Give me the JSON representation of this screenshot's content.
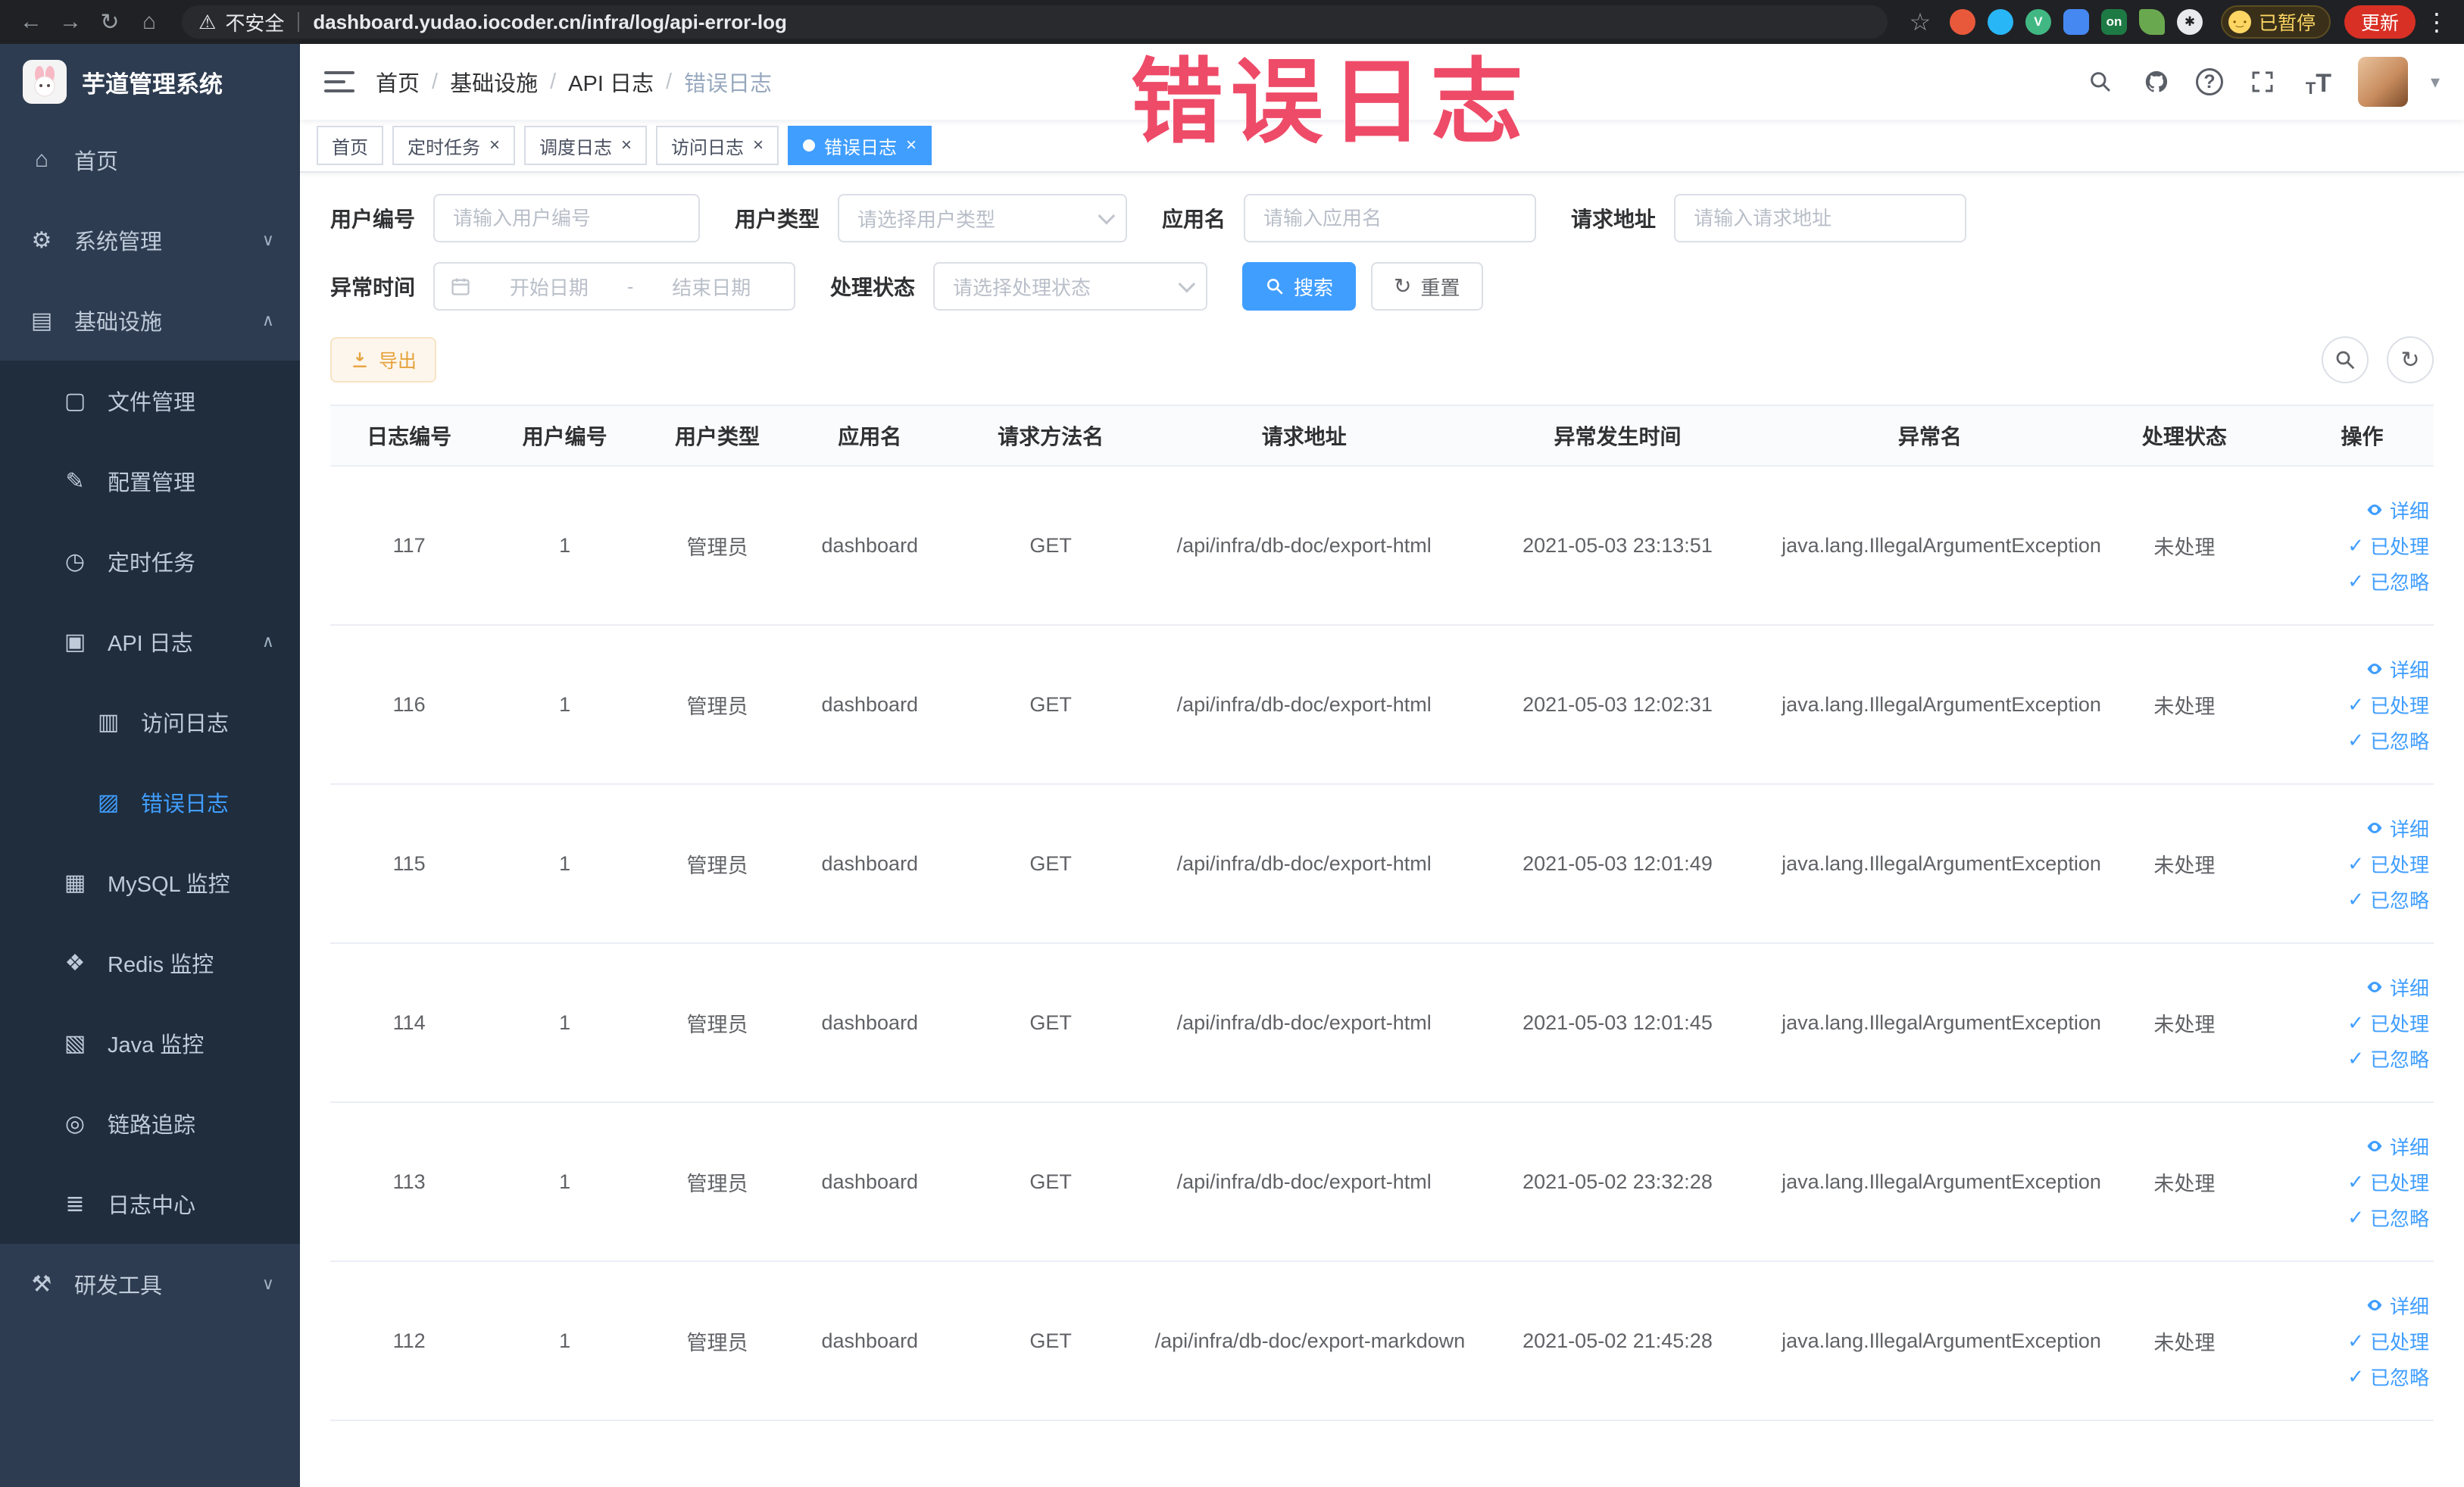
{
  "theme": {
    "accent": "#409eff",
    "warning": "#e6a23c",
    "annotation_red": "#ee4b68"
  },
  "browser": {
    "security_label": "不安全",
    "url": "dashboard.yudao.iocoder.cn/infra/log/api-error-log",
    "profile_chip": "已暂停",
    "update_button": "更新",
    "extensions": [
      {
        "shape": "circle",
        "color": "#e8593c"
      },
      {
        "shape": "circle",
        "color": "#29b6f6"
      },
      {
        "shape": "circle",
        "color": "#41b883",
        "glyph": "V"
      },
      {
        "shape": "square",
        "color": "#4688f1"
      },
      {
        "shape": "square",
        "color": "#1e7a44",
        "glyph": "on"
      },
      {
        "shape": "leaf",
        "color": "#6aa84f"
      },
      {
        "shape": "circle",
        "color": "#e8eaed",
        "glyph": "✱",
        "glyph_color": "#202124"
      }
    ]
  },
  "annotation": {
    "text": "错误日志",
    "color": "#ee4b68"
  },
  "sidebar": {
    "app_title": "芋道管理系统",
    "items": [
      {
        "label": "首页",
        "icon": "home-icon",
        "level": 1
      },
      {
        "label": "系统管理",
        "icon": "gear-icon",
        "level": 1,
        "arrow": "down"
      },
      {
        "label": "基础设施",
        "icon": "infra-icon",
        "level": 1,
        "arrow": "up"
      },
      {
        "label": "文件管理",
        "icon": "file-icon",
        "level": 2
      },
      {
        "label": "配置管理",
        "icon": "config-icon",
        "level": 2
      },
      {
        "label": "定时任务",
        "icon": "timer-icon",
        "level": 2
      },
      {
        "label": "API 日志",
        "icon": "api-log-icon",
        "level": 2,
        "arrow": "up"
      },
      {
        "label": "访问日志",
        "icon": "access-log-icon",
        "level": 3
      },
      {
        "label": "错误日志",
        "icon": "error-log-icon",
        "level": 3,
        "active": true
      },
      {
        "label": "MySQL 监控",
        "icon": "mysql-icon",
        "level": 2
      },
      {
        "label": "Redis 监控",
        "icon": "redis-icon",
        "level": 2
      },
      {
        "label": "Java 监控",
        "icon": "java-icon",
        "level": 2
      },
      {
        "label": "链路追踪",
        "icon": "trace-icon",
        "level": 2
      },
      {
        "label": "日志中心",
        "icon": "log-center-icon",
        "level": 2
      },
      {
        "label": "研发工具",
        "icon": "devtools-icon",
        "level": 1,
        "arrow": "down"
      }
    ]
  },
  "header": {
    "breadcrumb": [
      "首页",
      "基础设施",
      "API 日志",
      "错误日志"
    ]
  },
  "tags": [
    {
      "label": "首页",
      "closable": false,
      "active": false
    },
    {
      "label": "定时任务",
      "closable": true,
      "active": false
    },
    {
      "label": "调度日志",
      "closable": true,
      "active": false
    },
    {
      "label": "访问日志",
      "closable": true,
      "active": false
    },
    {
      "label": "错误日志",
      "closable": true,
      "active": true
    }
  ],
  "filters": {
    "user_id_label": "用户编号",
    "user_id_placeholder": "请输入用户编号",
    "user_type_label": "用户类型",
    "user_type_placeholder": "请选择用户类型",
    "app_name_label": "应用名",
    "app_name_placeholder": "请输入应用名",
    "req_addr_label": "请求地址",
    "req_addr_placeholder": "请输入请求地址",
    "time_label": "异常时间",
    "time_start_placeholder": "开始日期",
    "time_separator": "-",
    "time_end_placeholder": "结束日期",
    "status_label": "处理状态",
    "status_placeholder": "请选择处理状态",
    "search_button": "搜索",
    "reset_button": "重置"
  },
  "toolbar": {
    "export_button": "导出"
  },
  "table": {
    "columns": [
      "日志编号",
      "用户编号",
      "用户类型",
      "应用名",
      "请求方法名",
      "请求地址",
      "异常发生时间",
      "异常名",
      "处理状态",
      "操作"
    ],
    "actions": [
      "详细",
      "已处理",
      "已忽略"
    ],
    "rows": [
      {
        "id": "117",
        "user_id": "1",
        "user_type": "管理员",
        "app": "dashboard",
        "method": "GET",
        "url": "/api/infra/db-doc/export-html",
        "time": "2021-05-03 23:13:51",
        "exception": "java.lang.IllegalArgumentException",
        "status": "未处理"
      },
      {
        "id": "116",
        "user_id": "1",
        "user_type": "管理员",
        "app": "dashboard",
        "method": "GET",
        "url": "/api/infra/db-doc/export-html",
        "time": "2021-05-03 12:02:31",
        "exception": "java.lang.IllegalArgumentException",
        "status": "未处理"
      },
      {
        "id": "115",
        "user_id": "1",
        "user_type": "管理员",
        "app": "dashboard",
        "method": "GET",
        "url": "/api/infra/db-doc/export-html",
        "time": "2021-05-03 12:01:49",
        "exception": "java.lang.IllegalArgumentException",
        "status": "未处理"
      },
      {
        "id": "114",
        "user_id": "1",
        "user_type": "管理员",
        "app": "dashboard",
        "method": "GET",
        "url": "/api/infra/db-doc/export-html",
        "time": "2021-05-03 12:01:45",
        "exception": "java.lang.IllegalArgumentException",
        "status": "未处理"
      },
      {
        "id": "113",
        "user_id": "1",
        "user_type": "管理员",
        "app": "dashboard",
        "method": "GET",
        "url": "/api/infra/db-doc/export-html",
        "time": "2021-05-02 23:32:28",
        "exception": "java.lang.IllegalArgumentException",
        "status": "未处理"
      },
      {
        "id": "112",
        "user_id": "1",
        "user_type": "管理员",
        "app": "dashboard",
        "method": "GET",
        "url": "/api/infra/db-doc/export-markdown",
        "time": "2021-05-02 21:45:28",
        "exception": "java.lang.IllegalArgumentException",
        "status": "未处理"
      }
    ]
  }
}
